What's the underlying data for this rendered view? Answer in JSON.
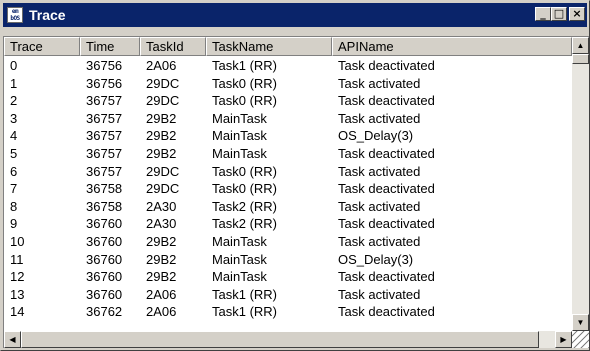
{
  "window": {
    "icon_text_top": "em",
    "icon_text_bottom": "bOS",
    "title": "Trace",
    "minimize": "_",
    "maximize": "□",
    "close": "×"
  },
  "table": {
    "columns": [
      "Trace",
      "Time",
      "TaskId",
      "TaskName",
      "APIName"
    ],
    "rows": [
      [
        "0",
        "36756",
        "2A06",
        "Task1 (RR)",
        "Task deactivated"
      ],
      [
        "1",
        "36756",
        "29DC",
        "Task0 (RR)",
        "Task activated"
      ],
      [
        "2",
        "36757",
        "29DC",
        "Task0 (RR)",
        "Task deactivated"
      ],
      [
        "3",
        "36757",
        "29B2",
        "MainTask",
        "Task activated"
      ],
      [
        "4",
        "36757",
        "29B2",
        "MainTask",
        "OS_Delay(3)"
      ],
      [
        "5",
        "36757",
        "29B2",
        "MainTask",
        "Task deactivated"
      ],
      [
        "6",
        "36757",
        "29DC",
        "Task0 (RR)",
        "Task activated"
      ],
      [
        "7",
        "36758",
        "29DC",
        "Task0 (RR)",
        "Task deactivated"
      ],
      [
        "8",
        "36758",
        "2A30",
        "Task2 (RR)",
        "Task activated"
      ],
      [
        "9",
        "36760",
        "2A30",
        "Task2 (RR)",
        "Task deactivated"
      ],
      [
        "10",
        "36760",
        "29B2",
        "MainTask",
        "Task activated"
      ],
      [
        "11",
        "36760",
        "29B2",
        "MainTask",
        "OS_Delay(3)"
      ],
      [
        "12",
        "36760",
        "29B2",
        "MainTask",
        "Task deactivated"
      ],
      [
        "13",
        "36760",
        "2A06",
        "Task1 (RR)",
        "Task activated"
      ],
      [
        "14",
        "36762",
        "2A06",
        "Task1 (RR)",
        "Task deactivated"
      ]
    ]
  },
  "scrollbars": {
    "up": "▲",
    "down": "▼",
    "left": "◀",
    "right": "▶"
  },
  "colors": {
    "titlebar": "#0a246a",
    "window_face": "#d4d0c8",
    "list_background": "#ffffff"
  }
}
